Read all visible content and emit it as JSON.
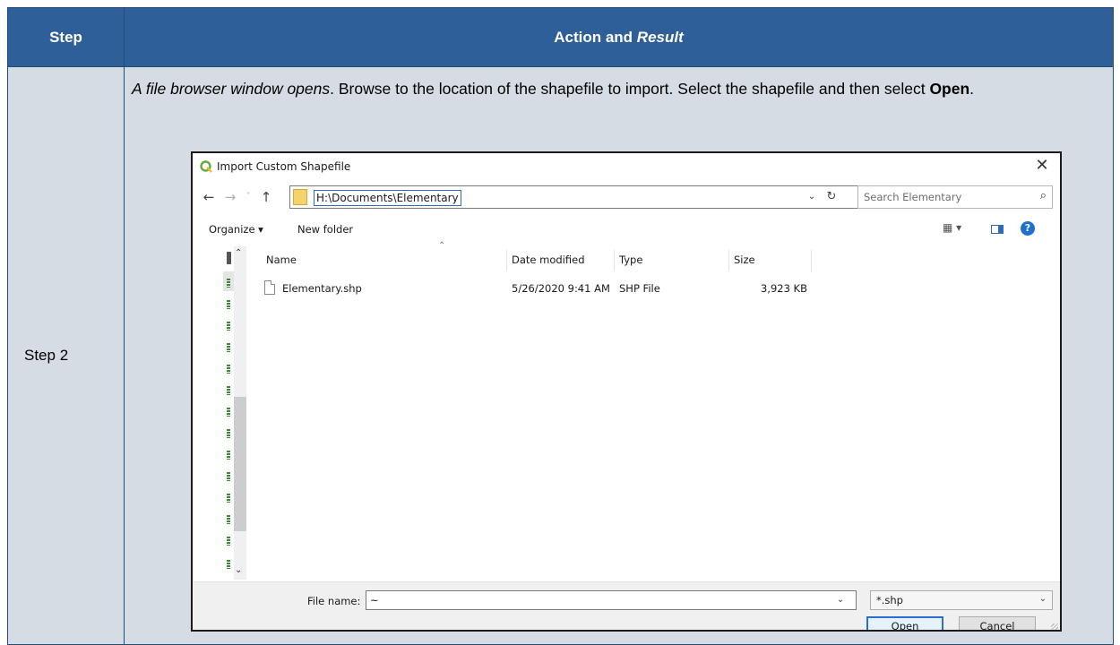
{
  "table": {
    "headers": {
      "step": "Step",
      "action_prefix": "Action and ",
      "action_italic": "Result"
    },
    "row": {
      "step": "Step 2",
      "instruction_italic": "A file browser window opens",
      "instruction_mid": ". Browse to the location of the shapefile to import. Select the shapefile and then select ",
      "instruction_bold": "Open",
      "instruction_end": "."
    }
  },
  "dialog": {
    "title": "Import Custom Shapefile",
    "address_path": "H:\\Documents\\Elementary",
    "search_placeholder": "Search Elementary",
    "toolbar": {
      "organize": "Organize ▾",
      "new_folder": "New folder"
    },
    "columns": [
      "Name",
      "Date modified",
      "Type",
      "Size"
    ],
    "files": [
      {
        "name": "Elementary.shp",
        "date": "5/26/2020 9:41 AM",
        "type": "SHP File",
        "size": "3,923 KB"
      }
    ],
    "footer": {
      "file_name_label": "File name:",
      "file_name_value": "~",
      "file_type": "*.shp",
      "open_label": "Open",
      "cancel_label": "Cancel"
    },
    "icons": {
      "back": "←",
      "forward": "→",
      "recent": "˅",
      "up": "↑",
      "refresh": "↻",
      "search": "⌕",
      "close": "✕",
      "chevron": "⌄"
    },
    "colors": {
      "accent": "#2a6ed1",
      "header_bg": "#2e5f98",
      "row_bg": "#d6dce4",
      "qgis_green": "#6aaa3a"
    }
  }
}
